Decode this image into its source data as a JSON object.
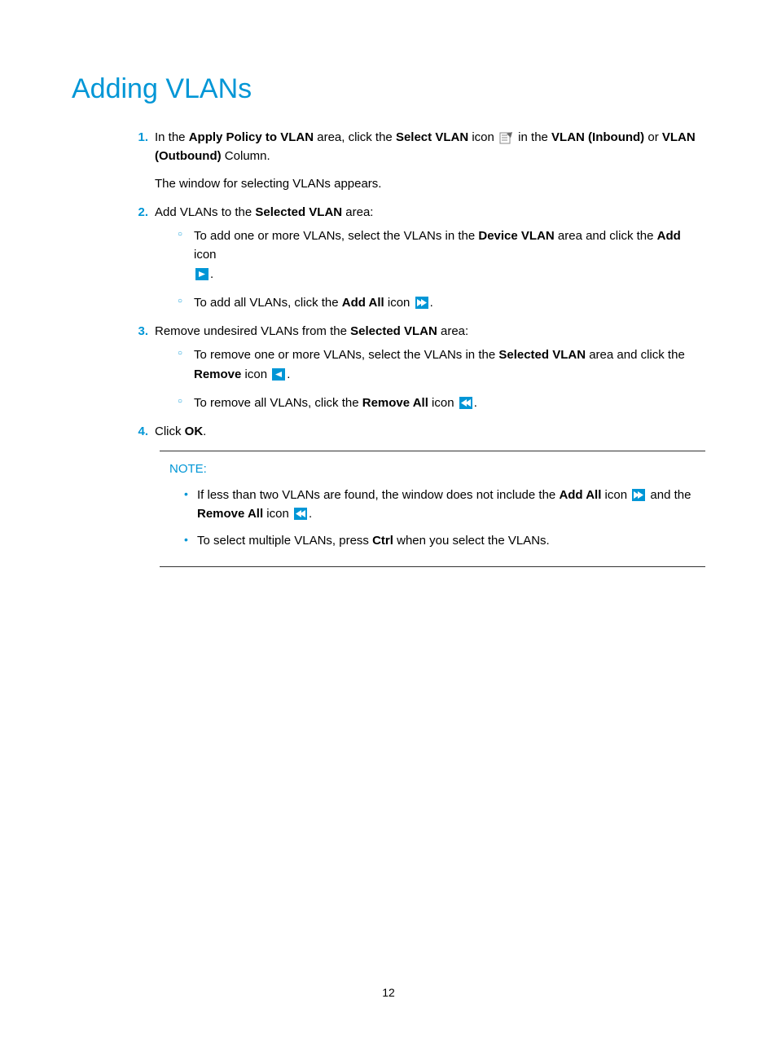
{
  "title": "Adding VLANs",
  "steps": {
    "s1": {
      "num": "1.",
      "pre": "In the ",
      "b1": "Apply Policy to VLAN",
      "mid1": " area, click the ",
      "b2": "Select VLAN",
      "mid2": " icon ",
      "iconName": "select-vlan-icon",
      "mid3": " in the ",
      "b3": "VLAN (Inbound)",
      "or": " or ",
      "b4": "VLAN (Outbound)",
      "post": " Column.",
      "sub": "The window for selecting VLANs appears."
    },
    "s2": {
      "num": "2.",
      "pre": "Add VLANs to the ",
      "b1": "Selected VLAN",
      "post": " area:",
      "c1": {
        "pre": "To add one or more VLANs, select the VLANs in the ",
        "b1": "Device VLAN",
        "mid": " area and click the ",
        "b2": "Add",
        "post": " icon ",
        "iconName": "add-icon",
        "dot": "."
      },
      "c2": {
        "pre": "To add all VLANs, click the ",
        "b1": "Add All",
        "post": " icon ",
        "iconName": "add-all-icon",
        "dot": "."
      }
    },
    "s3": {
      "num": "3.",
      "pre": "Remove undesired VLANs from the ",
      "b1": "Selected VLAN",
      "post": " area:",
      "c1": {
        "pre": "To remove one or more VLANs, select the VLANs in the ",
        "b1": "Selected VLAN",
        "mid": " area and click the ",
        "b2": "Remove",
        "post": " icon ",
        "iconName": "remove-icon",
        "dot": "."
      },
      "c2": {
        "pre": "To remove all VLANs, click the ",
        "b1": "Remove All",
        "post": " icon ",
        "iconName": "remove-all-icon",
        "dot": "."
      }
    },
    "s4": {
      "num": "4.",
      "pre": "Click ",
      "b1": "OK",
      "post": "."
    }
  },
  "note": {
    "title": "NOTE:",
    "n1": {
      "pre": "If less than two VLANs are found, the window does not include the ",
      "b1": "Add All",
      "mid1": " icon ",
      "icon1": "add-all-icon",
      "and": " and the ",
      "b2": "Remove All",
      "mid2": " icon ",
      "icon2": "remove-all-icon",
      "dot": "."
    },
    "n2": {
      "pre": "To select multiple VLANs, press ",
      "b1": "Ctrl",
      "post": " when you select the VLANs."
    }
  },
  "pageNumber": "12"
}
